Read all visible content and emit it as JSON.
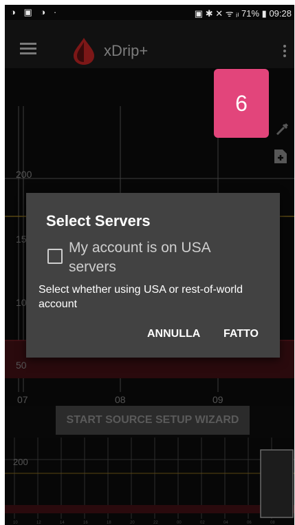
{
  "status_bar": {
    "left_icons": "◑ ▣ ◑ ·",
    "right_icons": "▣ ✱ ✕ ᯤ ᵢₗ",
    "battery": "71%",
    "battery_icon": "▮",
    "time": "09:28"
  },
  "app_bar": {
    "title": "xDrip+",
    "menu_icon": "hamburger-icon",
    "logo_icon": "blood-drop-icon",
    "overflow_icon": "more-vert-icon"
  },
  "bg_value": "6",
  "chart": {
    "y_ticks": [
      "200",
      "15",
      "10",
      "50"
    ],
    "x_ticks": [
      "07",
      "08",
      "09"
    ]
  },
  "wizard_button": "START SOURCE SETUP WIZARD",
  "preview_chart": {
    "y_ticks": [
      "200"
    ],
    "x_ticks": [
      "10",
      "12",
      "14",
      "16",
      "18",
      "20",
      "22",
      "00",
      "02",
      "04",
      "06",
      "08"
    ]
  },
  "dialog": {
    "title": "Select Servers",
    "checkbox_label": "My account is on USA servers",
    "checkbox_checked": false,
    "summary": "Select whether using USA or rest-of-world account",
    "cancel_label": "ANNULLA",
    "ok_label": "FATTO"
  },
  "colors": {
    "accent_pink": "#e2457b",
    "dialog_bg": "#424242",
    "high_line": "#8a6a1a",
    "low_band": "#3a0e12"
  }
}
